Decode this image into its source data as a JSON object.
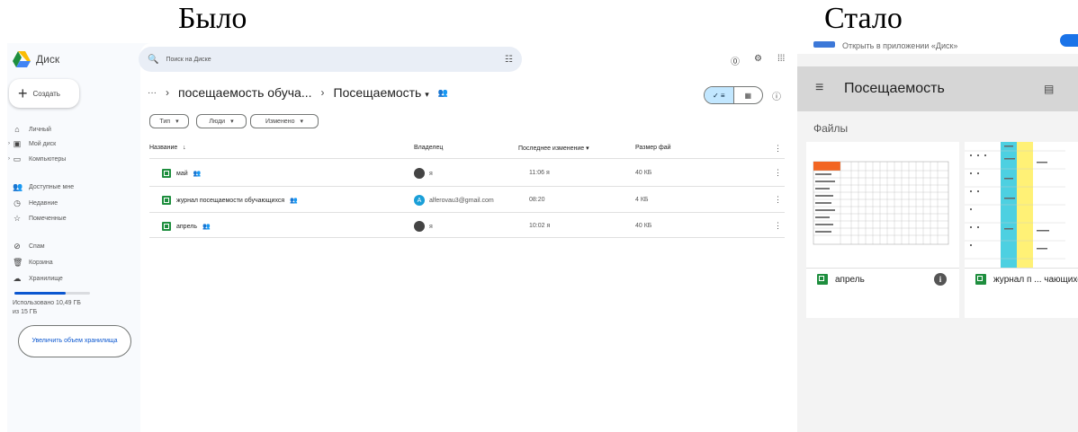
{
  "headings": {
    "before": "Было",
    "after": "Стало"
  },
  "before": {
    "app_name": "Диск",
    "create_label": "Создать",
    "search_placeholder": "Поиск на Диске",
    "nav": [
      {
        "label": "Личный",
        "icon": "home-icon"
      },
      {
        "label": "Мой диск",
        "icon": "my-drive-icon"
      },
      {
        "label": "Компьютеры",
        "icon": "computer-icon"
      },
      {
        "label": "Доступные мне",
        "icon": "shared-icon"
      },
      {
        "label": "Недавние",
        "icon": "clock-icon"
      },
      {
        "label": "Помеченные",
        "icon": "star-icon"
      },
      {
        "label": "Спам",
        "icon": "spam-icon"
      },
      {
        "label": "Корзина",
        "icon": "trash-icon"
      },
      {
        "label": "Хранилище",
        "icon": "cloud-icon"
      }
    ],
    "storage_text": "Использовано 10,49 ГБ из 15 ГБ",
    "upgrade_label": "Увеличить объем хранилища",
    "breadcrumb": {
      "parent": "посещаемость обуча...",
      "current": "Посещаемость"
    },
    "filters": [
      "Тип",
      "Люди",
      "Изменено"
    ],
    "columns": {
      "name": "Название",
      "owner": "Владелец",
      "modified": "Последнее изменение",
      "size": "Размер фай"
    },
    "files": [
      {
        "name": "май",
        "owner": "я",
        "modified": "11:06 я",
        "size": "40 КБ",
        "owner_avatar": "photo"
      },
      {
        "name": "журнал посещаемости обучающихся",
        "owner": "alferovau3@gmail.com",
        "modified": "08:20",
        "size": "4 КБ",
        "owner_avatar": "A"
      },
      {
        "name": "апрель",
        "owner": "я",
        "modified": "10:02 я",
        "size": "40 КБ",
        "owner_avatar": "photo"
      }
    ]
  },
  "after": {
    "open_in_app": "Открыть в приложении «Диск»",
    "title": "Посещаемость",
    "section_label": "Файлы",
    "cards": [
      {
        "name": "апрель"
      },
      {
        "name": "журнал п ... чающихся"
      }
    ]
  },
  "colors": {
    "sheets_green": "#1e8e3e",
    "accent_blue": "#0b57d0",
    "selected_toggle": "#c2e7ff"
  }
}
